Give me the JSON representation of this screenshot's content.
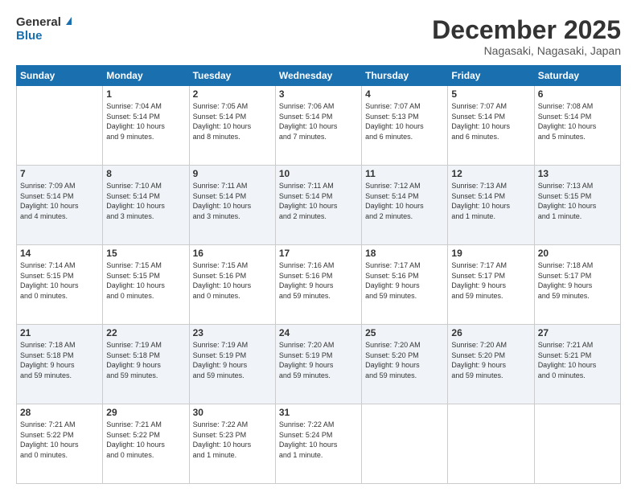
{
  "logo": {
    "text_general": "General",
    "text_blue": "Blue"
  },
  "header": {
    "title": "December 2025",
    "location": "Nagasaki, Nagasaki, Japan"
  },
  "calendar": {
    "days_of_week": [
      "Sunday",
      "Monday",
      "Tuesday",
      "Wednesday",
      "Thursday",
      "Friday",
      "Saturday"
    ],
    "weeks": [
      [
        {
          "day": "",
          "info": ""
        },
        {
          "day": "1",
          "info": "Sunrise: 7:04 AM\nSunset: 5:14 PM\nDaylight: 10 hours\nand 9 minutes."
        },
        {
          "day": "2",
          "info": "Sunrise: 7:05 AM\nSunset: 5:14 PM\nDaylight: 10 hours\nand 8 minutes."
        },
        {
          "day": "3",
          "info": "Sunrise: 7:06 AM\nSunset: 5:14 PM\nDaylight: 10 hours\nand 7 minutes."
        },
        {
          "day": "4",
          "info": "Sunrise: 7:07 AM\nSunset: 5:13 PM\nDaylight: 10 hours\nand 6 minutes."
        },
        {
          "day": "5",
          "info": "Sunrise: 7:07 AM\nSunset: 5:14 PM\nDaylight: 10 hours\nand 6 minutes."
        },
        {
          "day": "6",
          "info": "Sunrise: 7:08 AM\nSunset: 5:14 PM\nDaylight: 10 hours\nand 5 minutes."
        }
      ],
      [
        {
          "day": "7",
          "info": "Sunrise: 7:09 AM\nSunset: 5:14 PM\nDaylight: 10 hours\nand 4 minutes."
        },
        {
          "day": "8",
          "info": "Sunrise: 7:10 AM\nSunset: 5:14 PM\nDaylight: 10 hours\nand 3 minutes."
        },
        {
          "day": "9",
          "info": "Sunrise: 7:11 AM\nSunset: 5:14 PM\nDaylight: 10 hours\nand 3 minutes."
        },
        {
          "day": "10",
          "info": "Sunrise: 7:11 AM\nSunset: 5:14 PM\nDaylight: 10 hours\nand 2 minutes."
        },
        {
          "day": "11",
          "info": "Sunrise: 7:12 AM\nSunset: 5:14 PM\nDaylight: 10 hours\nand 2 minutes."
        },
        {
          "day": "12",
          "info": "Sunrise: 7:13 AM\nSunset: 5:14 PM\nDaylight: 10 hours\nand 1 minute."
        },
        {
          "day": "13",
          "info": "Sunrise: 7:13 AM\nSunset: 5:15 PM\nDaylight: 10 hours\nand 1 minute."
        }
      ],
      [
        {
          "day": "14",
          "info": "Sunrise: 7:14 AM\nSunset: 5:15 PM\nDaylight: 10 hours\nand 0 minutes."
        },
        {
          "day": "15",
          "info": "Sunrise: 7:15 AM\nSunset: 5:15 PM\nDaylight: 10 hours\nand 0 minutes."
        },
        {
          "day": "16",
          "info": "Sunrise: 7:15 AM\nSunset: 5:16 PM\nDaylight: 10 hours\nand 0 minutes."
        },
        {
          "day": "17",
          "info": "Sunrise: 7:16 AM\nSunset: 5:16 PM\nDaylight: 9 hours\nand 59 minutes."
        },
        {
          "day": "18",
          "info": "Sunrise: 7:17 AM\nSunset: 5:16 PM\nDaylight: 9 hours\nand 59 minutes."
        },
        {
          "day": "19",
          "info": "Sunrise: 7:17 AM\nSunset: 5:17 PM\nDaylight: 9 hours\nand 59 minutes."
        },
        {
          "day": "20",
          "info": "Sunrise: 7:18 AM\nSunset: 5:17 PM\nDaylight: 9 hours\nand 59 minutes."
        }
      ],
      [
        {
          "day": "21",
          "info": "Sunrise: 7:18 AM\nSunset: 5:18 PM\nDaylight: 9 hours\nand 59 minutes."
        },
        {
          "day": "22",
          "info": "Sunrise: 7:19 AM\nSunset: 5:18 PM\nDaylight: 9 hours\nand 59 minutes."
        },
        {
          "day": "23",
          "info": "Sunrise: 7:19 AM\nSunset: 5:19 PM\nDaylight: 9 hours\nand 59 minutes."
        },
        {
          "day": "24",
          "info": "Sunrise: 7:20 AM\nSunset: 5:19 PM\nDaylight: 9 hours\nand 59 minutes."
        },
        {
          "day": "25",
          "info": "Sunrise: 7:20 AM\nSunset: 5:20 PM\nDaylight: 9 hours\nand 59 minutes."
        },
        {
          "day": "26",
          "info": "Sunrise: 7:20 AM\nSunset: 5:20 PM\nDaylight: 9 hours\nand 59 minutes."
        },
        {
          "day": "27",
          "info": "Sunrise: 7:21 AM\nSunset: 5:21 PM\nDaylight: 10 hours\nand 0 minutes."
        }
      ],
      [
        {
          "day": "28",
          "info": "Sunrise: 7:21 AM\nSunset: 5:22 PM\nDaylight: 10 hours\nand 0 minutes."
        },
        {
          "day": "29",
          "info": "Sunrise: 7:21 AM\nSunset: 5:22 PM\nDaylight: 10 hours\nand 0 minutes."
        },
        {
          "day": "30",
          "info": "Sunrise: 7:22 AM\nSunset: 5:23 PM\nDaylight: 10 hours\nand 1 minute."
        },
        {
          "day": "31",
          "info": "Sunrise: 7:22 AM\nSunset: 5:24 PM\nDaylight: 10 hours\nand 1 minute."
        },
        {
          "day": "",
          "info": ""
        },
        {
          "day": "",
          "info": ""
        },
        {
          "day": "",
          "info": ""
        }
      ]
    ]
  }
}
